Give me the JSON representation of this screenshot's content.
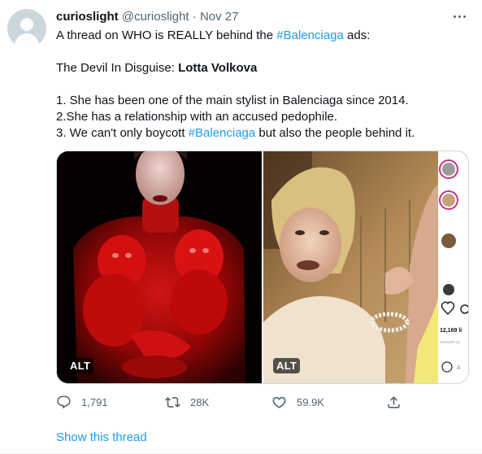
{
  "tweet": {
    "author": {
      "name": "curioslight",
      "handle": "@curioslight",
      "separator": "·",
      "date": "Nov 27"
    },
    "line1": {
      "prefix": "A thread on WHO is REALLY behind the ",
      "hashtag": "#Balenciaga",
      "suffix": " ads:"
    },
    "line2": {
      "prefix": "The Devil In Disguise: ",
      "bold": "Lotta Volkova"
    },
    "line3": "1. She has been one of the main stylist in Balenciaga since 2014.",
    "line4": "2.She has a relationship with an accused pedophile.",
    "line5": {
      "prefix": "3. We can't only boycott ",
      "hashtag": "#Balenciaga",
      "suffix": " but also the people behind it."
    },
    "media": {
      "left_alt": "ALT",
      "right_alt": "ALT",
      "right_overlay": {
        "likes": "12,169 li",
        "date": "AUGUST 13",
        "comment_hint": "A"
      }
    },
    "actions": {
      "replies": "1,791",
      "retweets": "28K",
      "likes": "59.9K"
    },
    "show_thread": "Show this thread"
  },
  "colors": {
    "link": "#1d9bf0",
    "secondary_text": "#536471",
    "text": "#0f1419",
    "border": "#cfd9de"
  }
}
